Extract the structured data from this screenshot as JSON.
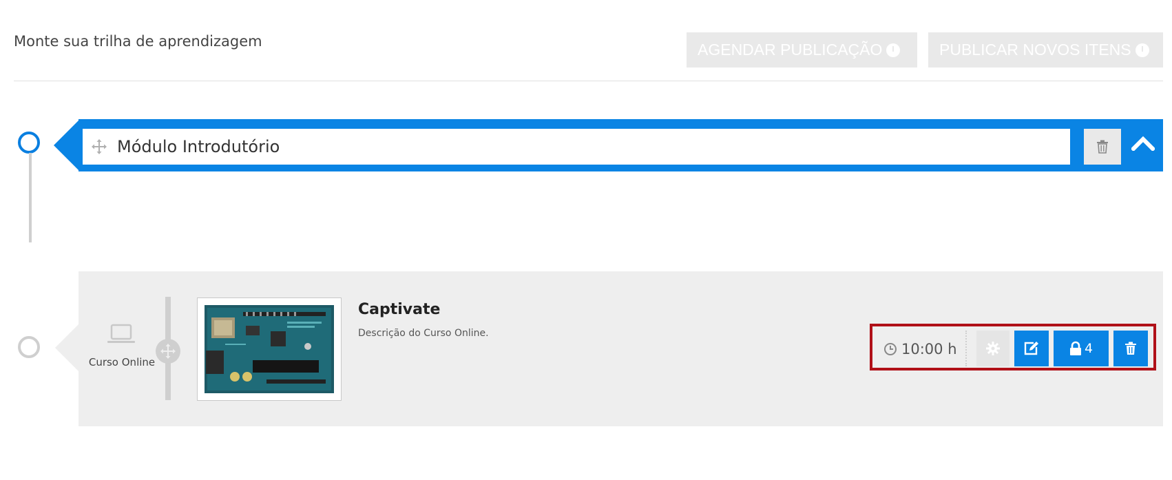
{
  "header": {
    "title": "Monte sua trilha de aprendizagem",
    "schedule_button": "AGENDAR PUBLICAÇÃO",
    "publish_button": "PUBLICAR NOVOS ITENS"
  },
  "module": {
    "name": "Módulo Introdutório",
    "icons": {
      "drag": "move-icon",
      "delete": "trash-icon",
      "collapse": "chevron-up-icon"
    }
  },
  "item": {
    "type_label": "Curso Online",
    "type_icon": "laptop-icon",
    "title": "Captivate",
    "description": "Descrição do Curso Online.",
    "thumbnail_icon": "circuit-board-image",
    "duration": "10:00 h",
    "lock_count": "4",
    "actions": [
      "settings-icon",
      "edit-icon",
      "lock-icon",
      "trash-icon"
    ]
  },
  "colors": {
    "accent": "#0a84e4",
    "muted_button": "#e9e9e9",
    "highlight_border": "#b01018",
    "card_bg": "#eeeeee"
  }
}
